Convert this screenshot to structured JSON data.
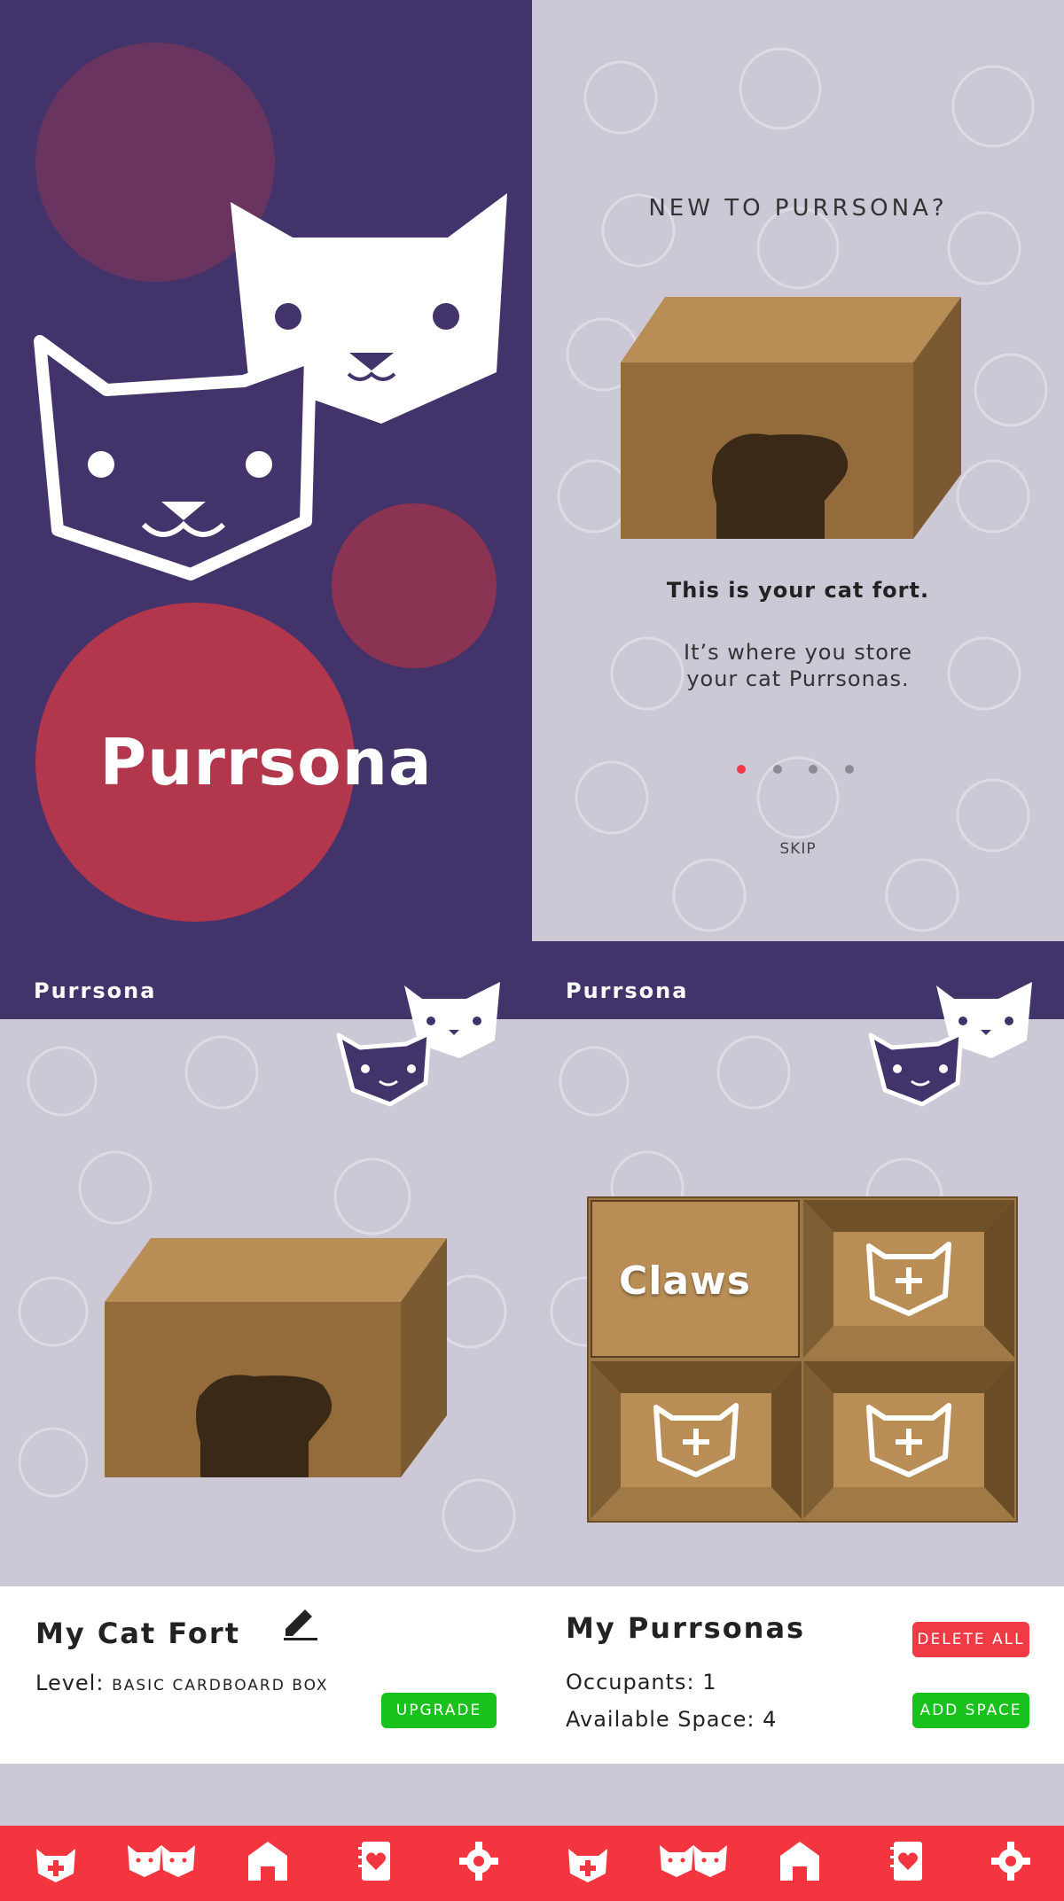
{
  "splash": {
    "app_name": "Purrsona",
    "colors": {
      "background": "#42336a",
      "accent_red": "#b3374c",
      "accent_plum": "#6a3460"
    }
  },
  "onboarding": {
    "heading": "NEW TO PURRSONA?",
    "bold_text": "This is your cat fort.",
    "desc_line1": "It’s where you store",
    "desc_line2": "your cat Purrsonas.",
    "pagination": {
      "total": 4,
      "active": 1
    },
    "skip_label": "SKIP",
    "illustration": "cardboard-box-icon"
  },
  "fort_screen": {
    "app_title": "Purrsona",
    "card_title": "My Cat Fort",
    "level_label": "Level:",
    "level_value": "BASIC CARDBOARD BOX",
    "upgrade_label": "UPGRADE"
  },
  "purrsonas_screen": {
    "app_title": "Purrsona",
    "card_title": "My Purrsonas",
    "delete_all_label": "DELETE ALL",
    "add_space_label": "ADD SPACE",
    "occupants_label": "Occupants:",
    "occupants_value": "1",
    "space_label": "Available Space:",
    "space_value": "4",
    "slots": [
      {
        "occupied": true,
        "name": "Claws"
      },
      {
        "occupied": false
      },
      {
        "occupied": false
      },
      {
        "occupied": false
      }
    ]
  },
  "bottom_nav": {
    "items": [
      "add-cat-icon",
      "cats-group-icon",
      "house-icon",
      "journal-heart-icon",
      "gear-icon"
    ],
    "color": "#f2353e"
  }
}
